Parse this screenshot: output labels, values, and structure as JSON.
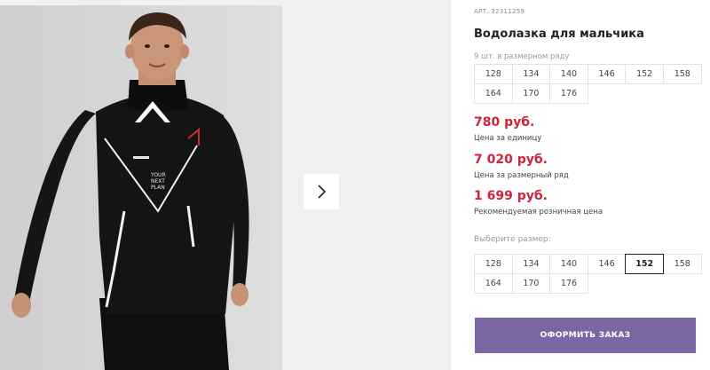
{
  "gallery": {
    "main_photo_alt": "",
    "shirt_print_lines": [
      "YOUR",
      "NEXT",
      "PLAN"
    ],
    "next_icon": "chevron-right-icon"
  },
  "product": {
    "sku": "АРТ. 32311259",
    "title": "Водолазка для мальчика",
    "pack_note": "9 шт. в размерном ряду",
    "pack_sizes": [
      "128",
      "134",
      "140",
      "146",
      "152",
      "158",
      "164",
      "170",
      "176"
    ],
    "unit_price": "780 руб.",
    "unit_price_label": "Цена за единицу",
    "pack_price": "7 020 руб.",
    "pack_price_label": "Цена за размерный ряд",
    "retail_price": "1 699 руб.",
    "retail_price_label": "Рекомендуемая розничная цена",
    "choose_size_label": "Выберите размер:",
    "select_sizes": [
      "128",
      "134",
      "140",
      "146",
      "152",
      "158",
      "164",
      "170",
      "176"
    ],
    "selected_size": "152",
    "order_button": "ОФОРМИТЬ ЗАКАЗ"
  },
  "colors": {
    "price": "#d0233a",
    "order_button": "#7b65a2",
    "shirt": "#111111"
  }
}
